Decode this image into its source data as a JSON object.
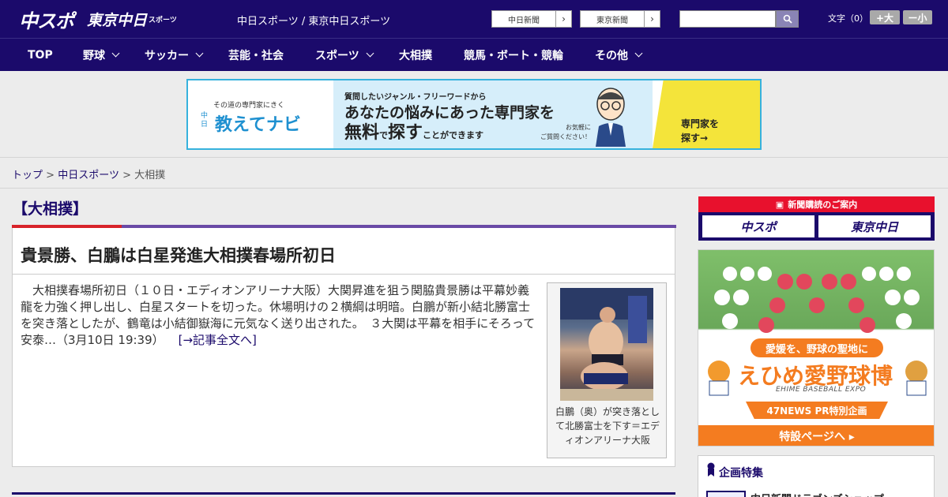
{
  "header": {
    "logo_primary": "中スポ",
    "logo_secondary": "東京中日",
    "logo_secondary_small": "スポーツ",
    "site_name": "中日スポーツ / 東京中日スポーツ",
    "paper_links": [
      {
        "label": "中日新聞"
      },
      {
        "label": "東京新聞"
      }
    ],
    "search_placeholder": "",
    "font_size_label": "文字（0）",
    "font_big": "+大",
    "font_small": "ー小"
  },
  "nav": {
    "items": [
      {
        "label": "TOP",
        "dropdown": false
      },
      {
        "label": "野球",
        "dropdown": true
      },
      {
        "label": "サッカー",
        "dropdown": true
      },
      {
        "label": "芸能・社会",
        "dropdown": false
      },
      {
        "label": "スポーツ",
        "dropdown": true
      },
      {
        "label": "大相撲",
        "dropdown": false
      },
      {
        "label": "競馬・ボート・競輪",
        "dropdown": false
      },
      {
        "label": "その他",
        "dropdown": true
      }
    ]
  },
  "top_ad": {
    "small": "その道の専門家にきく",
    "brand_pre": "中日",
    "brand": "教えてナビ",
    "line1": "質問したいジャンル・フリーワードから",
    "line2": "あなたの悩みにあった専門家を",
    "line3a": "無料",
    "line3b": "で",
    "line3c": "探す",
    "line3d": "ことができます",
    "note1": "お気軽に",
    "note2": "ご質問ください！",
    "cta1": "専門家を",
    "cta2": "探す→"
  },
  "breadcrumb": {
    "home": "トップ",
    "sep": ">",
    "section": "中日スポーツ",
    "current": "大相撲"
  },
  "main": {
    "category": "【大相撲】",
    "article": {
      "title": "貴景勝、白鵬は白星発進大相撲春場所初日",
      "body": "　大相撲春場所初日（１０日・エディオンアリーナ大阪）大関昇進を狙う関脇貴景勝は平幕妙義龍を力強く押し出し、白星スタートを切った。休場明けの２横綱は明暗。白鵬が新小結北勝富士を突き落としたが、鶴竜は小結御嶽海に元気なく送り出された。　３大関は平幕を相手にそろって安泰…（3月10日 19:39）",
      "more_link": "[→記事全文へ]",
      "photo_caption": "白鵬（奥）が突き落として北勝富士を下す＝エディオンアリーナ大阪"
    }
  },
  "sidebar": {
    "subscription_header": "新聞購読のご案内",
    "subscription_buttons": [
      {
        "label": "中スポ"
      },
      {
        "label": "東京中日"
      }
    ],
    "expo_ad": {
      "tag": "愛媛を、野球の聖地に",
      "title": "えひめ愛野球博",
      "subtitle": "EHIME BASEBALL EXPO",
      "band": "47NEWS PR特別企画",
      "cta": "特設ページへ ▸"
    },
    "feature": {
      "title": "企画特集",
      "item": "中日新聞ドラゴンズショップ"
    }
  },
  "colors": {
    "brand_navy": "#1b0a6b",
    "accent_red": "#d8232a",
    "accent_purple": "#6a4aa6",
    "ad_border": "#37b2dd",
    "expo_orange": "#f47c20"
  }
}
